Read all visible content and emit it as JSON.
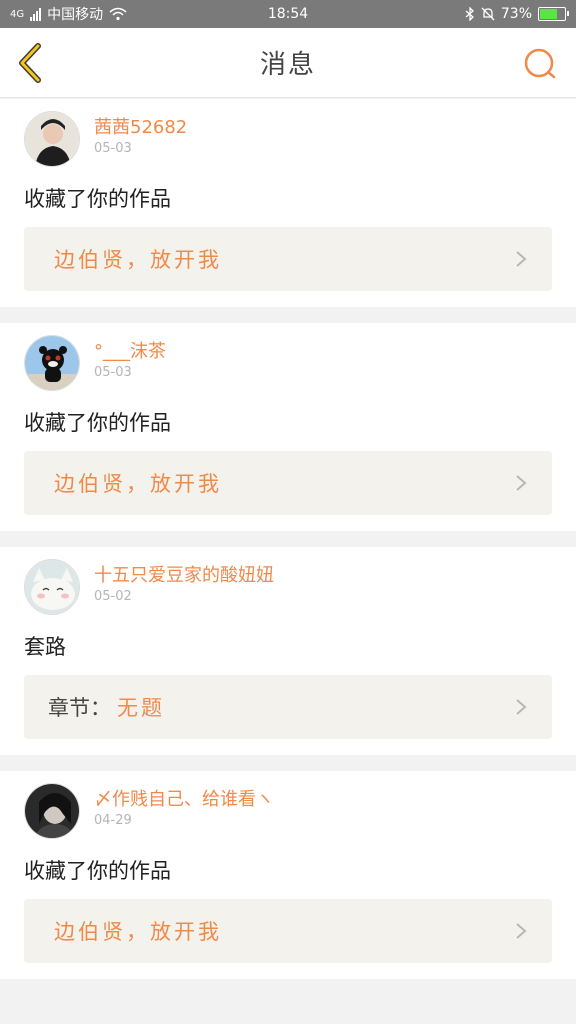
{
  "status_bar": {
    "network": "4G",
    "carrier": "中国移动",
    "time": "18:54",
    "battery": "73%",
    "battery_level": 0.73,
    "icons": [
      "signal-icon",
      "wifi-icon",
      "bluetooth-icon",
      "bell-muted-icon",
      "battery-icon"
    ]
  },
  "header": {
    "title": "消息",
    "back_icon": "back-arrow-icon",
    "search_icon": "search-icon"
  },
  "colors": {
    "accent": "#f08a4b",
    "back_icon": "#f5c518",
    "card_bg": "#f3f2ec",
    "page_bg": "#f2f2f2"
  },
  "messages": [
    {
      "username": "茜茜52682",
      "date": "05-03",
      "action": "收藏了你的作品",
      "work_title": "边伯贤，放开我",
      "chapter_label": ""
    },
    {
      "username": "°___沫茶",
      "date": "05-03",
      "action": "收藏了你的作品",
      "work_title": "边伯贤，放开我",
      "chapter_label": ""
    },
    {
      "username": "十五只爱豆家的酸妞妞",
      "date": "05-02",
      "action": "套路",
      "work_title": "无题",
      "chapter_label": "章节："
    },
    {
      "username": "〆作贱自己、给谁看ヽ",
      "date": "04-29",
      "action": "收藏了你的作品",
      "work_title": "边伯贤，放开我",
      "chapter_label": ""
    }
  ]
}
